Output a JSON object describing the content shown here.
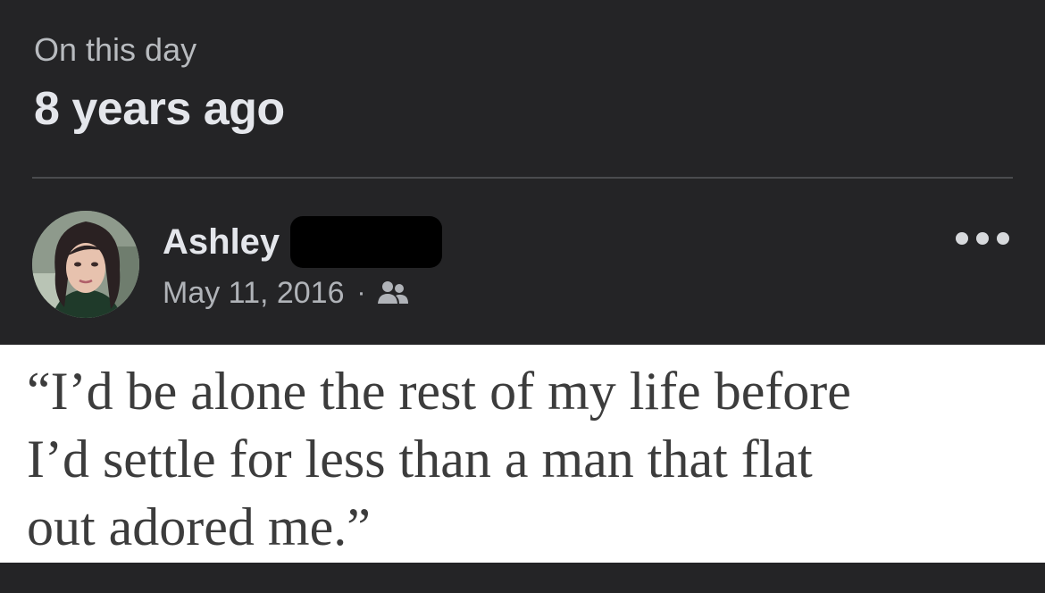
{
  "memory": {
    "label": "On this day",
    "title": "8 years ago"
  },
  "post": {
    "author_first_name": "Ashley",
    "author_last_name_redacted": true,
    "date": "May 11, 2016",
    "separator": "·",
    "audience_icon": "friends-icon",
    "more_icon": "more-options-icon",
    "quote_lines": [
      "“I’d be alone the rest of my life before",
      "I’d settle for less than a man that flat",
      "out adored me.”"
    ]
  },
  "colors": {
    "background": "#242426",
    "primary_text": "#e4e6eb",
    "secondary_text": "#b0b3b8",
    "quote_background": "#ffffff",
    "quote_text": "#3c3c3c"
  }
}
